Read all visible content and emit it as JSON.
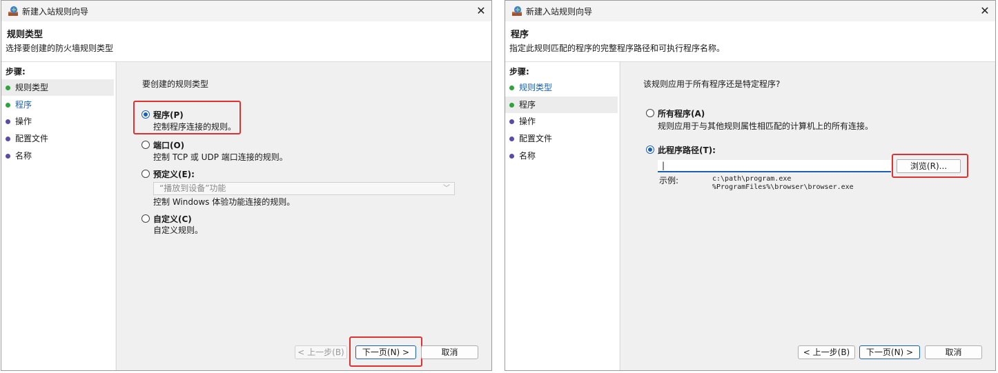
{
  "left": {
    "title": "新建入站规则向导",
    "header_title": "规则类型",
    "header_subtitle": "选择要创建的防火墙规则类型",
    "steps_label": "步骤:",
    "steps": [
      "规则类型",
      "程序",
      "操作",
      "配置文件",
      "名称"
    ],
    "question": "要创建的规则类型",
    "options": [
      {
        "title": "程序(P)",
        "desc": "控制程序连接的规则。"
      },
      {
        "title": "端口(O)",
        "desc": "控制 TCP 或 UDP 端口连接的规则。"
      },
      {
        "title": "预定义(E):",
        "desc": "控制 Windows 体验功能连接的规则。",
        "combo": "“播放到设备”功能"
      },
      {
        "title": "自定义(C)",
        "desc": "自定义规则。"
      }
    ],
    "selected_option": "程序(P)",
    "buttons": {
      "back": "< 上一步(B)",
      "next": "下一页(N) >",
      "cancel": "取消"
    }
  },
  "right": {
    "title": "新建入站规则向导",
    "header_title": "程序",
    "header_subtitle": "指定此规则匹配的程序的完整程序路径和可执行程序名称。",
    "steps_label": "步骤:",
    "steps": [
      "规则类型",
      "程序",
      "操作",
      "配置文件",
      "名称"
    ],
    "question": "该规则应用于所有程序还是特定程序?",
    "all_programs": {
      "title": "所有程序(A)",
      "desc": "规则应用于与其他规则属性相匹配的计算机上的所有连接。"
    },
    "this_program": {
      "title": "此程序路径(T):",
      "value": "|",
      "browse": "浏览(R)..."
    },
    "example_label": "示例:",
    "examples": [
      "c:\\path\\program.exe",
      "%ProgramFiles%\\browser\\browser.exe"
    ],
    "selected_option": "此程序路径(T):",
    "buttons": {
      "back": "< 上一步(B)",
      "next": "下一页(N) >",
      "cancel": "取消"
    }
  },
  "colors": {
    "accent": "#1a5fb4",
    "highlight": "#e03030",
    "step_done": "#2fa33d",
    "step_pending": "#5a4ba8"
  }
}
